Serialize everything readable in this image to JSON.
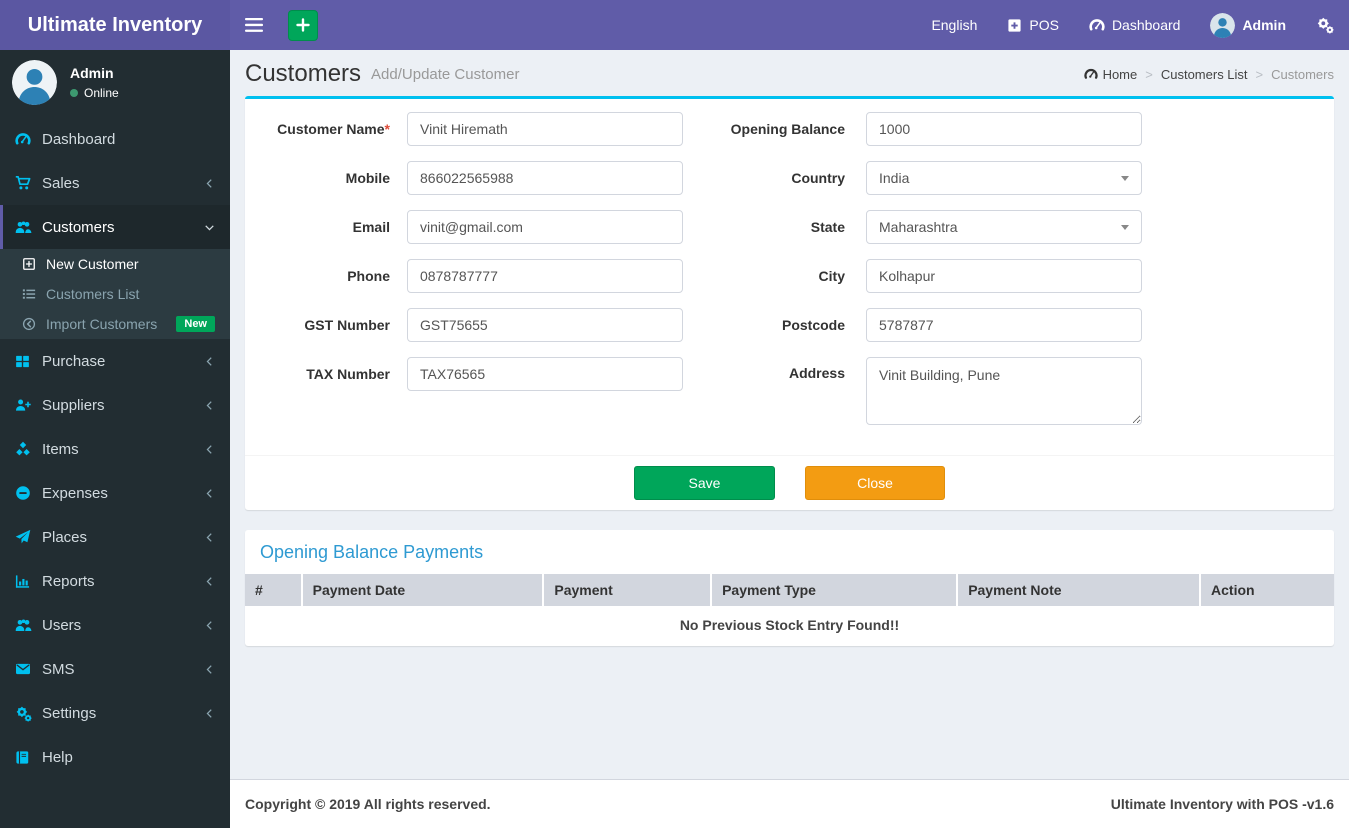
{
  "navbar": {
    "brand": "Ultimate Inventory",
    "language": "English",
    "pos_label": "POS",
    "dashboard_label": "Dashboard",
    "user_label": "Admin"
  },
  "sidebar": {
    "user_name": "Admin",
    "user_status": "Online",
    "items": [
      {
        "label": "Dashboard"
      },
      {
        "label": "Sales"
      },
      {
        "label": "Customers"
      },
      {
        "label": "Purchase"
      },
      {
        "label": "Suppliers"
      },
      {
        "label": "Items"
      },
      {
        "label": "Expenses"
      },
      {
        "label": "Places"
      },
      {
        "label": "Reports"
      },
      {
        "label": "Users"
      },
      {
        "label": "SMS"
      },
      {
        "label": "Settings"
      },
      {
        "label": "Help"
      }
    ],
    "submenu": [
      {
        "label": "New Customer"
      },
      {
        "label": "Customers List"
      },
      {
        "label": "Import Customers",
        "badge": "New"
      }
    ]
  },
  "page": {
    "title": "Customers",
    "subtitle": "Add/Update Customer",
    "breadcrumb": {
      "home": "Home",
      "parent": "Customers List",
      "current": "Customers"
    }
  },
  "form": {
    "left": [
      {
        "label": "Customer Name",
        "required": "*",
        "value": "Vinit Hiremath"
      },
      {
        "label": "Mobile",
        "value": "866022565988"
      },
      {
        "label": "Email",
        "value": "vinit@gmail.com"
      },
      {
        "label": "Phone",
        "value": "0878787777"
      },
      {
        "label": "GST Number",
        "value": "GST75655"
      },
      {
        "label": "TAX Number",
        "value": "TAX76565"
      }
    ],
    "right": [
      {
        "label": "Opening Balance",
        "value": "1000"
      },
      {
        "label": "Country",
        "value": "India",
        "type": "select"
      },
      {
        "label": "State",
        "value": "Maharashtra",
        "type": "select"
      },
      {
        "label": "City",
        "value": "Kolhapur"
      },
      {
        "label": "Postcode",
        "value": "5787877"
      },
      {
        "label": "Address",
        "value": "Vinit Building, Pune",
        "type": "textarea"
      }
    ],
    "save_label": "Save",
    "close_label": "Close"
  },
  "payments": {
    "title": "Opening Balance Payments",
    "columns": [
      "#",
      "Payment Date",
      "Payment",
      "Payment Type",
      "Payment Note",
      "Action"
    ],
    "empty_message": "No Previous Stock Entry Found!!"
  },
  "footer": {
    "copyright": "Copyright © 2019 All rights reserved.",
    "version": "Ultimate Inventory with POS -v1.6"
  },
  "colors": {
    "navbar_purple": "#605ca8",
    "sidebar_dark": "#222d32",
    "icon_cyan": "#00c0ef",
    "success_green": "#00a65a",
    "warning_orange": "#f39c12",
    "section_title_blue": "#2e9ad2",
    "danger_red": "#dd4b39"
  }
}
